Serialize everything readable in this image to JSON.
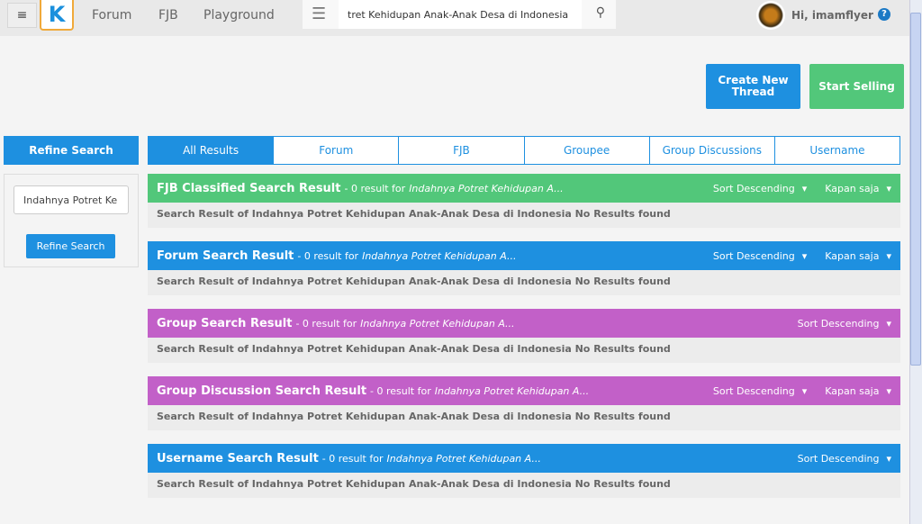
{
  "header": {
    "nav": [
      "Forum",
      "FJB",
      "Playground"
    ],
    "search_value": "tret Kehidupan Anak-Anak Desa di Indonesia",
    "greeting": "Hi, imamflyer",
    "help": "?",
    "logo": "K"
  },
  "actions": {
    "create": "Create New Thread",
    "sell": "Start Selling"
  },
  "sidebar": {
    "title": "Refine Search",
    "input_value": "Indahnya Potret Ke",
    "button": "Refine Search"
  },
  "tabs": [
    "All Results",
    "Forum",
    "FJB",
    "Groupee",
    "Group Discussions",
    "Username"
  ],
  "sections": [
    {
      "title": "FJB Classified Search Result",
      "count": "- 0 result for",
      "query": "Indahnya Potret Kehidupan A...",
      "sort": "Sort Descending",
      "time": "Kapan saja",
      "color": "#52c77a",
      "body": "Search Result of Indahnya Potret Kehidupan Anak-Anak Desa di Indonesia No Results found"
    },
    {
      "title": "Forum Search Result",
      "count": "- 0 result for",
      "query": "Indahnya Potret Kehidupan A...",
      "sort": "Sort Descending",
      "time": "Kapan saja",
      "color": "#1e90e0",
      "body": "Search Result of Indahnya Potret Kehidupan Anak-Anak Desa di Indonesia No Results found"
    },
    {
      "title": "Group Search Result",
      "count": "- 0 result for",
      "query": "Indahnya Potret Kehidupan A...",
      "sort": "Sort Descending",
      "color": "#c260c8",
      "body": "Search Result of Indahnya Potret Kehidupan Anak-Anak Desa di Indonesia No Results found"
    },
    {
      "title": "Group Discussion Search Result",
      "count": "- 0 result for",
      "query": "Indahnya Potret Kehidupan A...",
      "sort": "Sort Descending",
      "time": "Kapan saja",
      "color": "#c260c8",
      "body": "Search Result of Indahnya Potret Kehidupan Anak-Anak Desa di Indonesia No Results found"
    },
    {
      "title": "Username Search Result",
      "count": "- 0 result for",
      "query": "Indahnya Potret Kehidupan A...",
      "sort": "Sort Descending",
      "color": "#1e90e0",
      "body": "Search Result of Indahnya Potret Kehidupan Anak-Anak Desa di Indonesia No Results found"
    }
  ]
}
